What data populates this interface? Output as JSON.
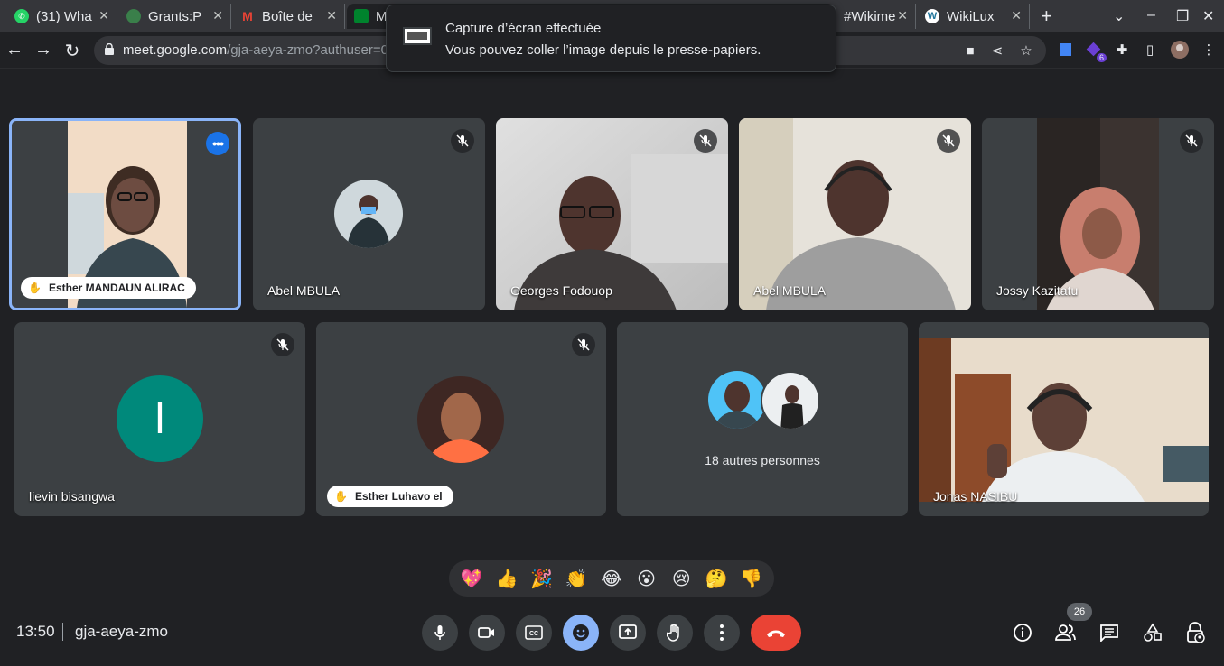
{
  "browser": {
    "tabs": [
      {
        "title": "(31) Wha",
        "fav": "whatsapp-icon",
        "color": "#25d366"
      },
      {
        "title": "Grants:P",
        "fav": "wikimedia-icon",
        "color": "#3a7f4a"
      },
      {
        "title": "Boîte de",
        "fav": "gmail-icon",
        "color": "#ea4335"
      },
      {
        "title": "M",
        "fav": "meet-icon",
        "color": "#00832d"
      },
      {
        "title": "#Wikime",
        "fav": "tab-icon",
        "color": "#9aa0a6"
      },
      {
        "title": "WikiLux",
        "fav": "wordpress-icon",
        "color": "#21759b"
      }
    ],
    "url_host": "meet.google.com",
    "url_path": "/gja-aeya-zmo?authuser=0",
    "ext_badge": "6"
  },
  "toast": {
    "title": "Capture d’écran effectuée",
    "message": "Vous pouvez coller l’image depuis le presse-papiers."
  },
  "participants": [
    {
      "name": "Esther MANDAUN ALIRAC",
      "hand_raised": true,
      "muted": false,
      "active": true
    },
    {
      "name": "Abel MBULA",
      "muted": true
    },
    {
      "name": "Georges Fodouop",
      "muted": true
    },
    {
      "name": "Abel MBULA",
      "muted": true
    },
    {
      "name": "Jossy Kazitatu",
      "muted": true
    },
    {
      "name": "lievin bisangwa",
      "muted": true,
      "initial": "l"
    },
    {
      "name": "Esther Luhavo el",
      "hand_raised": true,
      "muted": true
    },
    {
      "name": "18 autres personnes"
    },
    {
      "name": "Jonas NASIBU"
    }
  ],
  "reactions": [
    "💖",
    "👍",
    "🎉",
    "👏",
    "😂",
    "😮",
    "😢",
    "🤔",
    "👎"
  ],
  "meeting": {
    "time": "13:50",
    "code": "gja-aeya-zmo",
    "people_count": "26"
  },
  "colors": {
    "accent": "#8ab4f8",
    "end_call": "#ea4335",
    "tile": "#3c4043",
    "bg": "#202124"
  }
}
